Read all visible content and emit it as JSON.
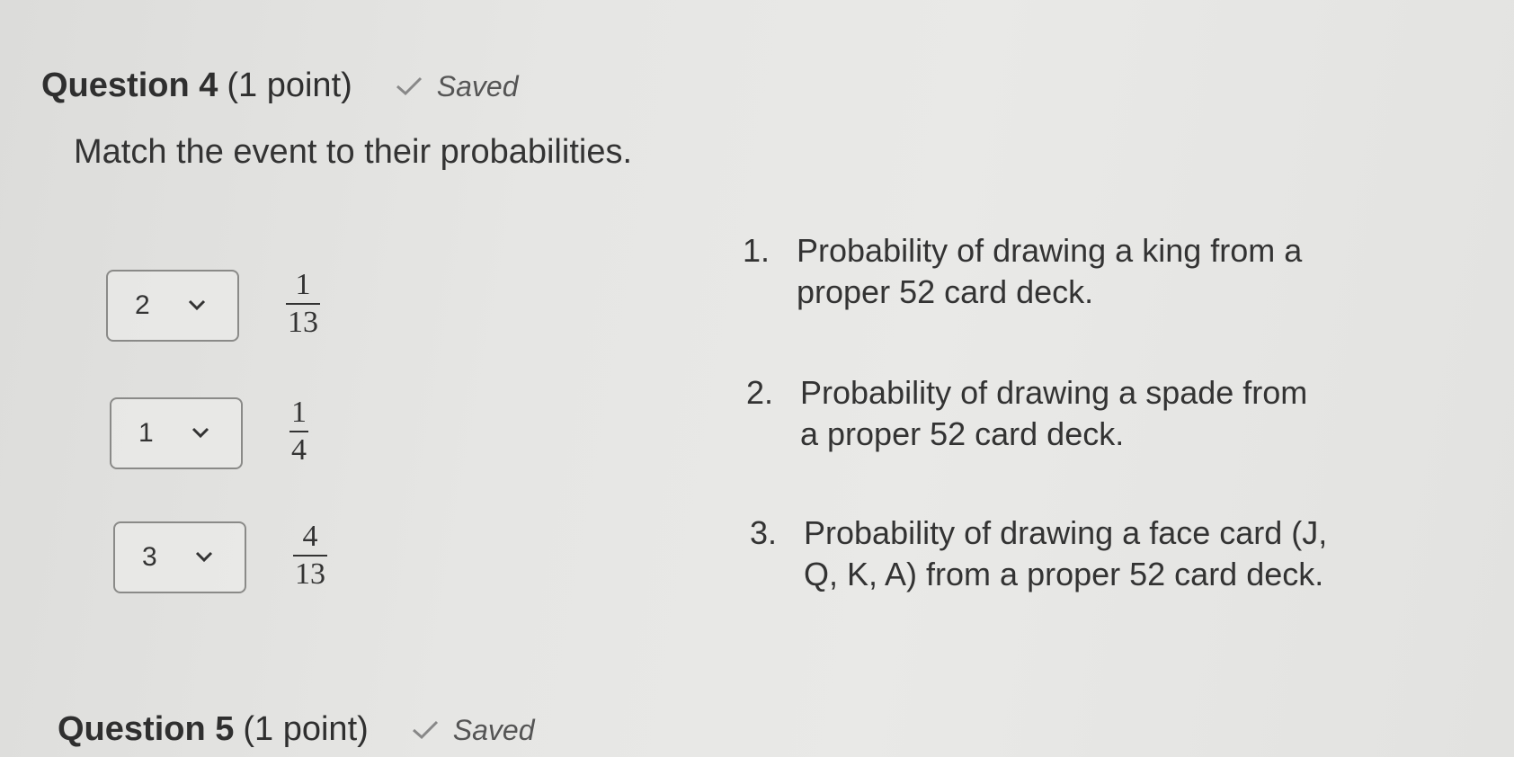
{
  "question4": {
    "title": "Question 4",
    "points": "(1 point)",
    "status": "Saved",
    "status_icon": "check-icon",
    "prompt": "Match the event to their probabilities.",
    "matches": [
      {
        "selected": "2",
        "numerator": "1",
        "denominator": "13"
      },
      {
        "selected": "1",
        "numerator": "1",
        "denominator": "4"
      },
      {
        "selected": "3",
        "numerator": "4",
        "denominator": "13"
      }
    ],
    "items": [
      {
        "index": "1.",
        "line1": "Probability of drawing a king from a",
        "line2": "proper 52 card deck."
      },
      {
        "index": "2.",
        "line1": "Probability of drawing a spade from",
        "line2": "a proper 52 card deck."
      },
      {
        "index": "3.",
        "line1": "Probability of drawing a face card (J,",
        "line2": "Q, K, A) from a proper 52 card deck."
      }
    ]
  },
  "question5": {
    "title": "Question 5",
    "points": "(1 point)",
    "status": "Saved",
    "status_icon": "check-icon"
  },
  "colors": {
    "background": "#e6e6e4",
    "text": "#2f2f2f",
    "border": "#8a8a88"
  }
}
